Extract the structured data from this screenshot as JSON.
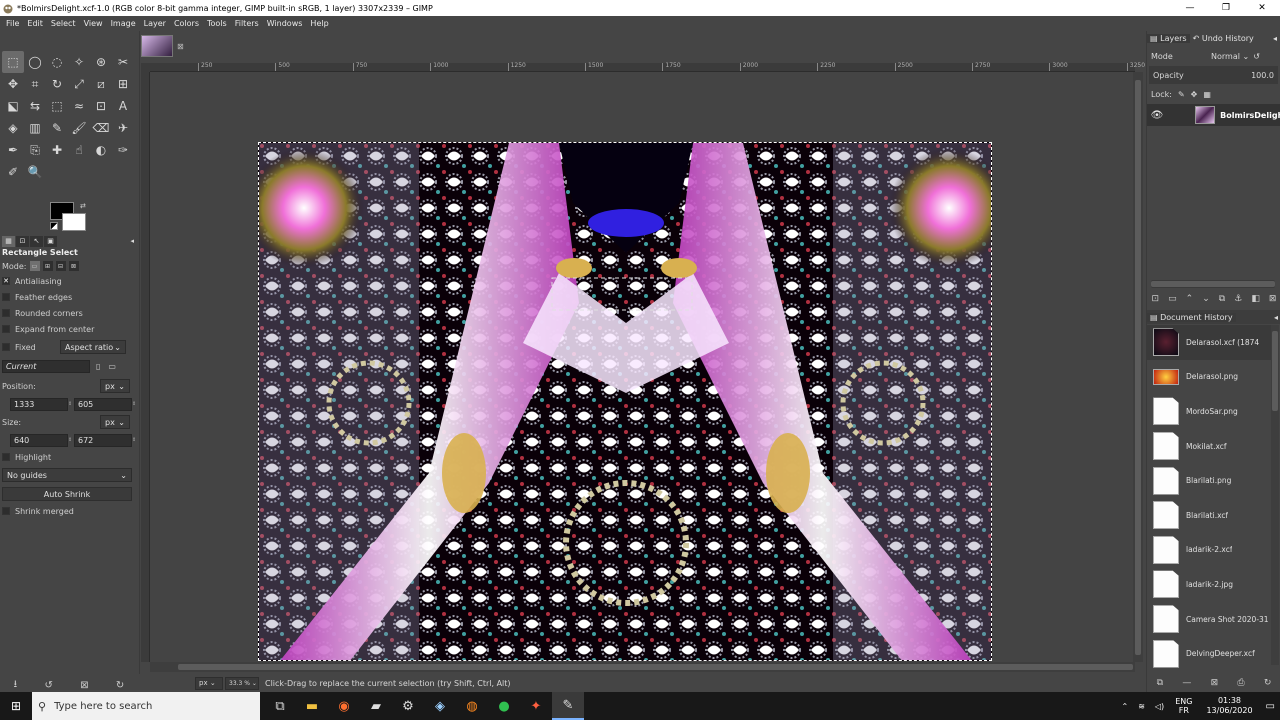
{
  "window": {
    "title": "*BolmirsDelight.xcf-1.0 (RGB color 8-bit gamma integer, GIMP built-in sRGB, 1 layer) 3307x2339 – GIMP",
    "minimize_glyph": "—",
    "maximize_glyph": "❐",
    "close_glyph": "✕"
  },
  "menu": [
    "File",
    "Edit",
    "Select",
    "View",
    "Image",
    "Layer",
    "Colors",
    "Tools",
    "Filters",
    "Windows",
    "Help"
  ],
  "toolbox": {
    "tools": [
      "rect-select",
      "ellipse-select",
      "free-select",
      "fuzzy-select",
      "by-color-select",
      "scissors",
      "move",
      "crop",
      "rotate",
      "scale",
      "shear",
      "align",
      "perspective",
      "flip",
      "cage",
      "warp",
      "unified-transform",
      "text",
      "bucket-fill",
      "blend",
      "pencil",
      "paintbrush",
      "eraser",
      "airbrush",
      "ink",
      "clone",
      "heal",
      "smudge",
      "dodge",
      "path",
      "color-picker",
      "zoom"
    ],
    "tool_glyphs": [
      "⬚",
      "◯",
      "◌",
      "✧",
      "⊛",
      "✂",
      "✥",
      "⌗",
      "↻",
      "⤢",
      "⧄",
      "⊞",
      "⬕",
      "⇆",
      "⬚",
      "≈",
      "⊡",
      "A",
      "◈",
      "▥",
      "✎",
      "🖌",
      "⌫",
      "✈",
      "✒",
      "⎘",
      "✚",
      "☝",
      "◐",
      "✑",
      "✐",
      "🔍"
    ],
    "fg_color": "#000000",
    "bg_color": "#ffffff",
    "options": {
      "title": "Rectangle Select",
      "mode_label": "Mode:",
      "antialiasing": "Antialiasing",
      "antialiasing_checked": "✕",
      "feather_edges": "Feather edges",
      "rounded_corners": "Rounded corners",
      "expand_from_center": "Expand from center",
      "fixed": "Fixed",
      "fixed_mode": "Aspect ratio",
      "current": "Current",
      "position_label": "Position:",
      "position_unit": "px",
      "position_x": "1333",
      "position_y": "605",
      "size_label": "Size:",
      "size_unit": "px",
      "size_w": "640",
      "size_h": "672",
      "highlight": "Highlight",
      "guides": "No guides",
      "auto_shrink": "Auto Shrink",
      "shrink_merged": "Shrink merged"
    }
  },
  "ruler": {
    "ticks": [
      "250",
      "500",
      "750",
      "1000",
      "1250",
      "1500",
      "1750",
      "2000",
      "2250",
      "2500",
      "2750",
      "3000",
      "3250"
    ]
  },
  "status": {
    "unit": "px",
    "zoom": "33.3 %",
    "message": "Click-Drag to replace the current selection (try Shift, Ctrl, Alt)"
  },
  "dock": {
    "tabs": [
      "Layers",
      "Undo History"
    ],
    "mode_label": "Mode",
    "mode_value": "Normal",
    "opacity_label": "Opacity",
    "opacity_value": "100.0",
    "lock_label": "Lock:",
    "layer_name": "BolmirsDelight",
    "doc_history_title": "Document History",
    "documents": [
      "Delarasol.xcf (1874",
      "Delarasol.png",
      "MordoSar.png",
      "Mokilat.xcf",
      "Blarilati.png",
      "Blarilati.xcf",
      "ladarik-2.xcf",
      "ladarik-2.jpg",
      "Camera Shot 2020-31",
      "DelvingDeeper.xcf"
    ]
  },
  "taskbar": {
    "search_placeholder": "Type here to search",
    "lang_top": "ENG",
    "lang_bottom": "FR",
    "time": "01:38",
    "date": "13/06/2020"
  }
}
